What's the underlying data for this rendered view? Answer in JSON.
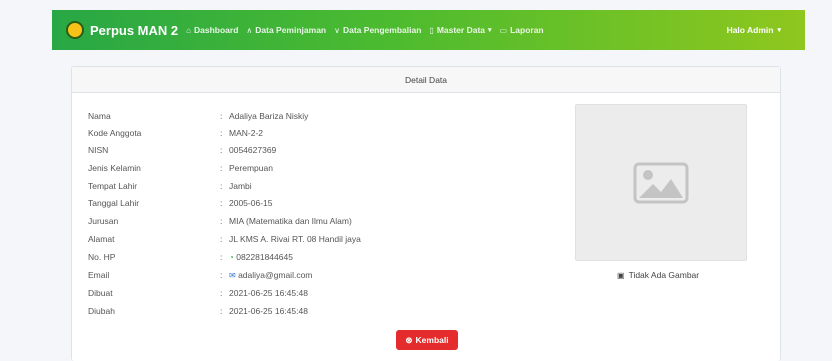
{
  "nav": {
    "brand": "Perpus MAN 2",
    "items": [
      {
        "icon": "monitor-icon",
        "glyph": "⌂",
        "label": "Dashboard"
      },
      {
        "icon": "arrow-up-icon",
        "glyph": "∧",
        "label": "Data Peminjaman"
      },
      {
        "icon": "arrow-down-icon",
        "glyph": "∨",
        "label": "Data Pengembalian"
      },
      {
        "icon": "folder-icon",
        "glyph": "▯",
        "label": "Master Data"
      },
      {
        "icon": "file-icon",
        "glyph": "▭",
        "label": "Laporan"
      }
    ],
    "user": "Halo Admin"
  },
  "card": {
    "title": "Detail Data",
    "rows": [
      {
        "label": "Nama",
        "value": "Adaliya Bariza Niskiy"
      },
      {
        "label": "Kode Anggota",
        "value": "MAN-2-2"
      },
      {
        "label": "NISN",
        "value": "0054627369"
      },
      {
        "label": "Jenis Kelamin",
        "value": "Perempuan"
      },
      {
        "label": "Tempat Lahir",
        "value": "Jambi"
      },
      {
        "label": "Tanggal Lahir",
        "value": "2005-06-15"
      },
      {
        "label": "Jurusan",
        "value": "MIA (Matematika dan Ilmu Alam)"
      },
      {
        "label": "Alamat",
        "value": "JL KMS A. Rivai RT. 08 Handil jaya"
      },
      {
        "label": "No. HP",
        "value": "082281844645"
      },
      {
        "label": "Email",
        "value": "adaliya@gmail.com"
      },
      {
        "label": "Dibuat",
        "value": "2021-06-25 16:45:48"
      },
      {
        "label": "Diubah",
        "value": "2021-06-25 16:45:48"
      }
    ],
    "colon": ":",
    "image_caption": "Tidak Ada Gambar",
    "back_button": "Kembali"
  },
  "colors": {
    "navbar_start": "#28a745",
    "navbar_end": "#8fc71e",
    "button": "#e52c2c",
    "whatsapp": "#25a244"
  }
}
